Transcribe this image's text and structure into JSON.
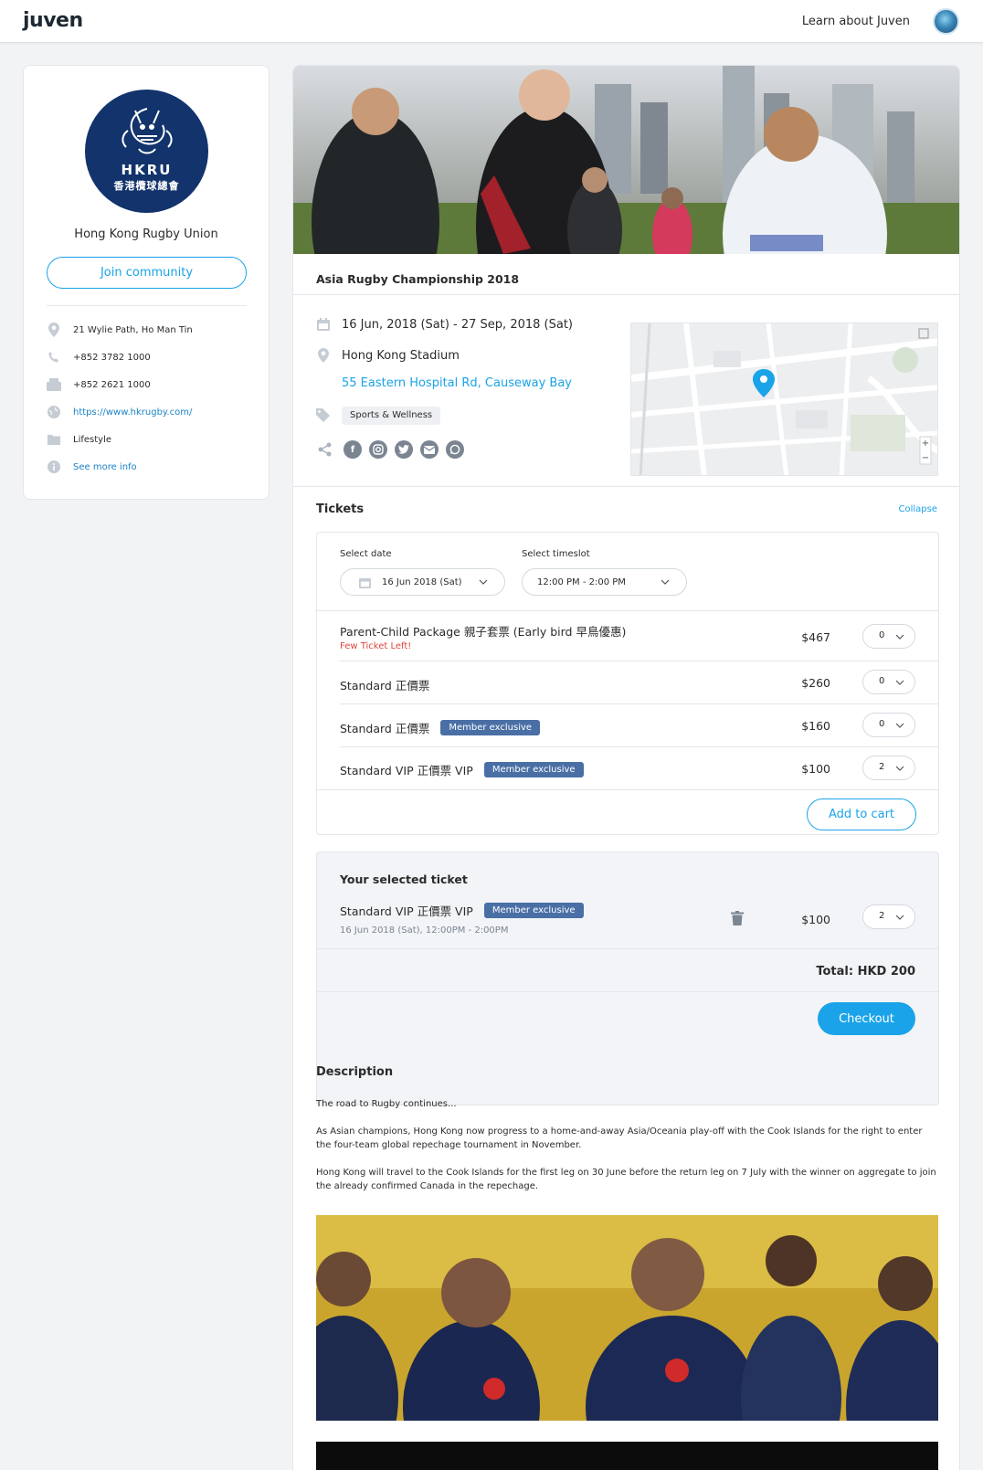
{
  "header": {
    "logo": "juven",
    "learn_link": "Learn about Juven"
  },
  "sidebar": {
    "org_logo": {
      "line1": "HKRU",
      "line2": "香港欖球總會"
    },
    "org_name": "Hong Kong Rugby Union",
    "join_label": "Join community",
    "info": [
      {
        "icon": "location-pin-icon",
        "text": "21 Wylie Path, Ho Man Tin"
      },
      {
        "icon": "phone-icon",
        "text": "+852 3782 1000"
      },
      {
        "icon": "fax-icon",
        "text": "+852 2621 1000"
      },
      {
        "icon": "globe-icon",
        "text": "https://www.hkrugby.com/"
      },
      {
        "icon": "folder-icon",
        "text": "Lifestyle"
      },
      {
        "icon": "info-icon",
        "text": "See more info"
      }
    ]
  },
  "event": {
    "title": "Asia Rugby Championship 2018",
    "date_range": "16 Jun, 2018 (Sat) - 27 Sep, 2018 (Sat)",
    "venue": "Hong Kong Stadium",
    "address": "55 Eastern Hospital Rd, Causeway Bay",
    "tag": "Sports & Wellness",
    "socials": [
      "facebook-icon",
      "instagram-icon",
      "twitter-icon",
      "email-icon",
      "whatsapp-icon"
    ]
  },
  "tickets": {
    "heading": "Tickets",
    "collapse_label": "Collapse",
    "date_label": "Select date",
    "date_value": "16 Jun 2018 (Sat)",
    "timeslot_label": "Select timeslot",
    "timeslot_value": "12:00 PM - 2:00 PM",
    "items": [
      {
        "name": "Parent-Child Package 親子套票 (Early bird 早鳥優惠)",
        "note": "Few Ticket Left!",
        "badge": "",
        "price": "$467",
        "qty": "0"
      },
      {
        "name": "Standard 正價票",
        "note": "",
        "badge": "",
        "price": "$260",
        "qty": "0"
      },
      {
        "name": "Standard 正價票",
        "note": "",
        "badge": "Member exclusive",
        "price": "$160",
        "qty": "0"
      },
      {
        "name": "Standard VIP 正價票 VIP",
        "note": "",
        "badge": "Member exclusive",
        "price": "$100",
        "qty": "2"
      }
    ],
    "add_to_cart_label": "Add to cart"
  },
  "selected": {
    "heading": "Your selected ticket",
    "name": "Standard VIP 正價票 VIP",
    "badge": "Member exclusive",
    "datetime": "16 Jun 2018 (Sat), 12:00PM - 2:00PM",
    "price": "$100",
    "qty": "2",
    "total": "Total: HKD 200",
    "checkout_label": "Checkout"
  },
  "description": {
    "heading": "Description",
    "paragraphs": [
      "The road to Rugby continues...",
      "As Asian champions, Hong Kong now progress to a home-and-away Asia/Oceania play-off with the Cook Islands for the right to enter the four-team global repechage tournament in November.",
      "Hong Kong will travel to the Cook Islands for the first leg on 30 June before the return leg on 7 July with the winner on aggregate to join the already confirmed Canada in the repechage."
    ]
  },
  "colors": {
    "accent": "#1aa3e8",
    "badge": "#4a6fa5",
    "warning": "#e0463c",
    "org_logo_bg": "#12336b"
  }
}
